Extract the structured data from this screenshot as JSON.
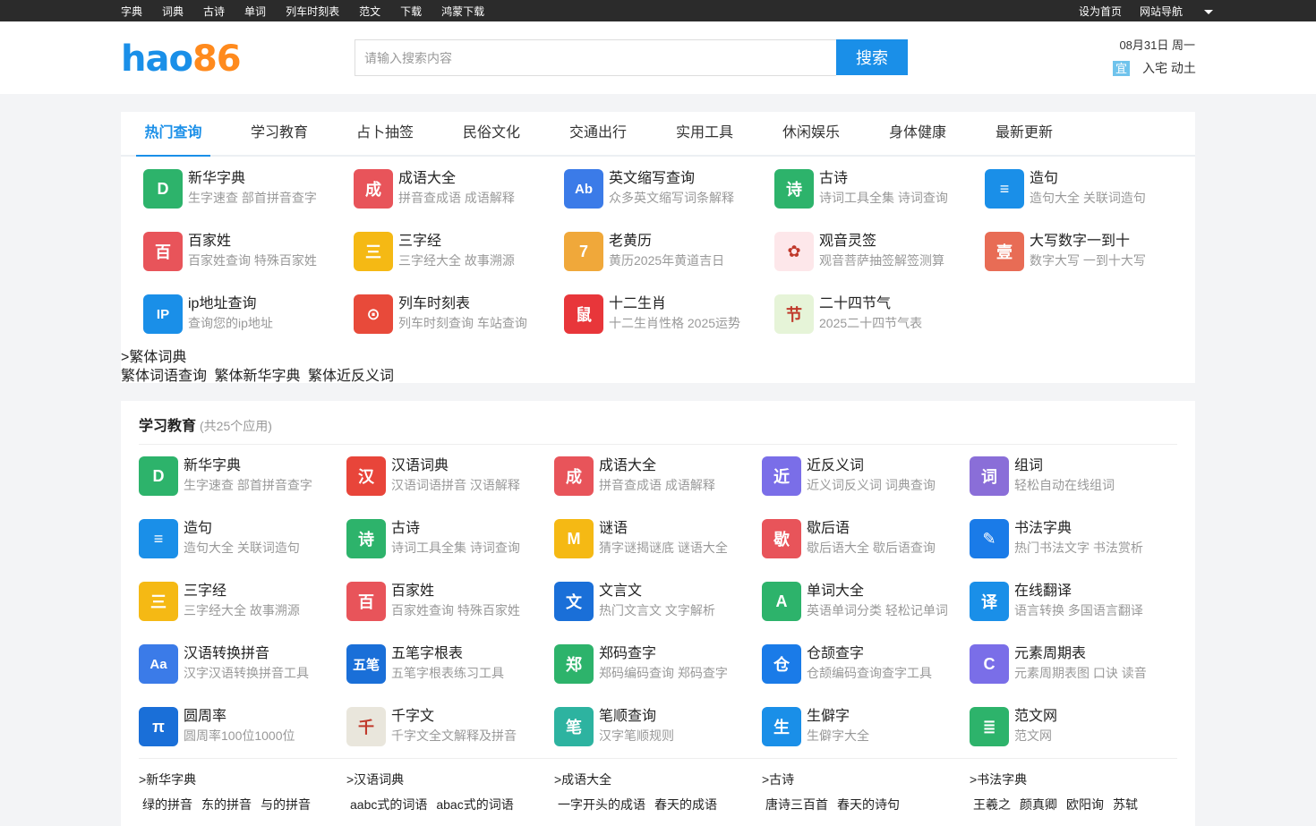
{
  "topbar": {
    "left": [
      "字典",
      "词典",
      "古诗",
      "单词",
      "列车时刻表",
      "范文",
      "下载",
      "鸿蒙下载"
    ],
    "right_home": "设为首页",
    "right_nav": "网站导航"
  },
  "header": {
    "logo_a": "hao",
    "logo_b": "86",
    "search_placeholder": "请输入搜索内容",
    "search_button": "搜索",
    "date": "08月31日 周一",
    "yi_badge": "宜",
    "yi_text": "入宅 动土"
  },
  "tabs": [
    "热门查询",
    "学习教育",
    "占卜抽签",
    "民俗文化",
    "交通出行",
    "实用工具",
    "休闲娱乐",
    "身体健康",
    "最新更新"
  ],
  "hot_apps": [
    {
      "title": "新华字典",
      "desc": "生字速查 部首拼音查字",
      "icon": "book-d-icon",
      "color": "#2db36b",
      "glyph": "D"
    },
    {
      "title": "成语大全",
      "desc": "拼音查成语 成语解释",
      "icon": "idiom-book-icon",
      "color": "#e8545a",
      "glyph": "成"
    },
    {
      "title": "英文缩写查询",
      "desc": "众多英文缩写词条解释",
      "icon": "ab-icon",
      "color": "#3b7be8",
      "glyph": "Ab"
    },
    {
      "title": "古诗",
      "desc": "诗词工具全集 诗词查询",
      "icon": "poem-icon",
      "color": "#2db36b",
      "glyph": "诗"
    },
    {
      "title": "造句",
      "desc": "造句大全 关联词造句",
      "icon": "chat-bubble-icon",
      "color": "#1a8fe8",
      "glyph": "≡"
    },
    {
      "title": "百家姓",
      "desc": "百家姓查询 特殊百家姓",
      "icon": "surname-icon",
      "color": "#e8545a",
      "glyph": "百"
    },
    {
      "title": "三字经",
      "desc": "三字经大全 故事溯源",
      "icon": "scroll-icon",
      "color": "#f5b914",
      "glyph": "三"
    },
    {
      "title": "老黄历",
      "desc": "黄历2025年黄道吉日",
      "icon": "calendar-icon",
      "color": "#f0a83a",
      "glyph": "7"
    },
    {
      "title": "观音灵签",
      "desc": "观音菩萨抽签解签测算",
      "icon": "lotus-icon",
      "color": "#fde7ea",
      "glyph": "✿"
    },
    {
      "title": "大写数字一到十",
      "desc": "数字大写 一到十大写",
      "icon": "number-convert-icon",
      "color": "#e86c55",
      "glyph": "壹"
    },
    {
      "title": "ip地址查询",
      "desc": "查询您的ip地址",
      "icon": "ip-icon",
      "color": "#1a8fe8",
      "glyph": "IP"
    },
    {
      "title": "列车时刻表",
      "desc": "列车时刻查询 车站查询",
      "icon": "train-icon",
      "color": "#e84a3a",
      "glyph": "⊙"
    },
    {
      "title": "十二生肖",
      "desc": "十二生肖性格 2025运势",
      "icon": "zodiac-icon",
      "color": "#e8363a",
      "glyph": "鼠"
    },
    {
      "title": "二十四节气",
      "desc": "2025二十四节气表",
      "icon": "solar-term-icon",
      "color": "#e6f4d8",
      "glyph": "节"
    }
  ],
  "fanti": {
    "title": ">繁体词典",
    "links": [
      "繁体词语查询",
      "繁体新华字典",
      "繁体近反义词"
    ]
  },
  "edu": {
    "title": "学习教育",
    "count": "(共25个应用)",
    "apps": [
      {
        "title": "新华字典",
        "desc": "生字速查 部首拼音查字",
        "icon": "book-d-icon",
        "color": "#2db36b",
        "glyph": "D"
      },
      {
        "title": "汉语词典",
        "desc": "汉语词语拼音 汉语解释",
        "icon": "han-icon",
        "color": "#e8453a",
        "glyph": "汉"
      },
      {
        "title": "成语大全",
        "desc": "拼音查成语 成语解释",
        "icon": "idiom-book-icon",
        "color": "#e8545a",
        "glyph": "成"
      },
      {
        "title": "近反义词",
        "desc": "近义词反义词 词典查询",
        "icon": "synonym-icon",
        "color": "#7a6ee8",
        "glyph": "近"
      },
      {
        "title": "组词",
        "desc": "轻松自动在线组词",
        "icon": "word-group-icon",
        "color": "#8a6ed8",
        "glyph": "词"
      },
      {
        "title": "造句",
        "desc": "造句大全 关联词造句",
        "icon": "chat-bubble-icon",
        "color": "#1a8fe8",
        "glyph": "≡"
      },
      {
        "title": "古诗",
        "desc": "诗词工具全集 诗词查询",
        "icon": "poem-icon",
        "color": "#2db36b",
        "glyph": "诗"
      },
      {
        "title": "谜语",
        "desc": "猜字谜揭谜底 谜语大全",
        "icon": "puzzle-icon",
        "color": "#f5b914",
        "glyph": "M"
      },
      {
        "title": "歇后语",
        "desc": "歇后语大全 歇后语查询",
        "icon": "xiehouyu-icon",
        "color": "#e8545a",
        "glyph": "歇"
      },
      {
        "title": "书法字典",
        "desc": "热门书法文字 书法赏析",
        "icon": "brush-icon",
        "color": "#1a7be8",
        "glyph": "✎"
      },
      {
        "title": "三字经",
        "desc": "三字经大全 故事溯源",
        "icon": "scroll-icon",
        "color": "#f5b914",
        "glyph": "三"
      },
      {
        "title": "百家姓",
        "desc": "百家姓查询 特殊百家姓",
        "icon": "surname-icon",
        "color": "#e8545a",
        "glyph": "百"
      },
      {
        "title": "文言文",
        "desc": "热门文言文 文字解析",
        "icon": "classical-text-icon",
        "color": "#1a6fd8",
        "glyph": "文"
      },
      {
        "title": "单词大全",
        "desc": "英语单词分类 轻松记单词",
        "icon": "letter-a-icon",
        "color": "#2db36b",
        "glyph": "A"
      },
      {
        "title": "在线翻译",
        "desc": "语言转换 多国语言翻译",
        "icon": "translate-icon",
        "color": "#1a8fe8",
        "glyph": "译"
      },
      {
        "title": "汉语转换拼音",
        "desc": "汉字汉语转换拼音工具",
        "icon": "pinyin-icon",
        "color": "#3b7be8",
        "glyph": "Aa"
      },
      {
        "title": "五笔字根表",
        "desc": "五笔字根表练习工具",
        "icon": "wubi-icon",
        "color": "#1a6fd8",
        "glyph": "五笔"
      },
      {
        "title": "郑码查字",
        "desc": "郑码编码查询 郑码查字",
        "icon": "zhengma-icon",
        "color": "#2db36b",
        "glyph": "郑"
      },
      {
        "title": "仓颉查字",
        "desc": "仓颉编码查询查字工具",
        "icon": "cangjie-icon",
        "color": "#1a7be8",
        "glyph": "仓"
      },
      {
        "title": "元素周期表",
        "desc": "元素周期表图 口诀 读音",
        "icon": "element-icon",
        "color": "#7a6ee8",
        "glyph": "C"
      },
      {
        "title": "圆周率",
        "desc": "圆周率100位1000位",
        "icon": "pi-icon",
        "color": "#1a6fd8",
        "glyph": "π"
      },
      {
        "title": "千字文",
        "desc": "千字文全文解释及拼音",
        "icon": "qianziwen-icon",
        "color": "#e9e6dc",
        "glyph": "千"
      },
      {
        "title": "笔顺查询",
        "desc": "汉字笔顺规则",
        "icon": "stroke-order-icon",
        "color": "#2db3a0",
        "glyph": "笔"
      },
      {
        "title": "生僻字",
        "desc": "生僻字大全",
        "icon": "rare-char-icon",
        "color": "#1a8fe8",
        "glyph": "生"
      },
      {
        "title": "范文网",
        "desc": "范文网",
        "icon": "document-icon",
        "color": "#2db36b",
        "glyph": "≣"
      }
    ],
    "subs": [
      {
        "title": ">新华字典",
        "links": [
          "绿的拼音",
          "东的拼音",
          "与的拼音"
        ]
      },
      {
        "title": ">汉语词典",
        "links": [
          "aabc式的词语",
          "abac式的词语"
        ]
      },
      {
        "title": ">成语大全",
        "links": [
          "一字开头的成语",
          "春天的成语"
        ]
      },
      {
        "title": ">古诗",
        "links": [
          "唐诗三百首",
          "春天的诗句"
        ]
      },
      {
        "title": ">书法字典",
        "links": [
          "王羲之",
          "颜真卿",
          "欧阳询",
          "苏轼"
        ]
      }
    ]
  }
}
